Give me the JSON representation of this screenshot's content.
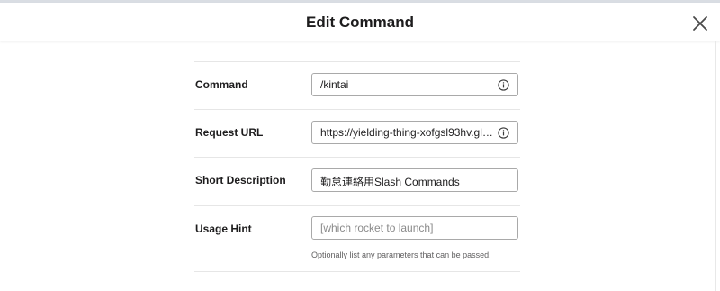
{
  "dialog": {
    "title": "Edit Command",
    "close_icon": "close-icon"
  },
  "fields": {
    "command": {
      "label": "Command",
      "value": "/kintai",
      "icon": "info-icon"
    },
    "request_url": {
      "label": "Request URL",
      "value": "https://yielding-thing-xofgsl93hv.gli...",
      "icon": "info-icon"
    },
    "short_description": {
      "label": "Short Description",
      "value": "勤怠連絡用Slash Commands"
    },
    "usage_hint": {
      "label": "Usage Hint",
      "placeholder": "[which rocket to launch]",
      "help": "Optionally list any parameters that can be passed."
    }
  }
}
